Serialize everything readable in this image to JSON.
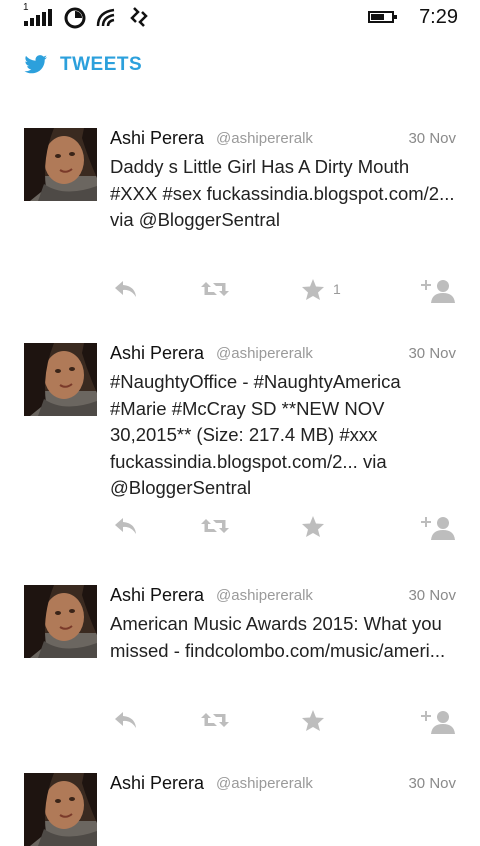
{
  "status_bar": {
    "signal_label": "1",
    "time": "7:29",
    "battery_level": 0.7
  },
  "header": {
    "icon": "twitter-bird-icon",
    "title": "TWEETS",
    "accent_color": "#2CA0DC"
  },
  "tweets": [
    {
      "name": "Ashi Perera",
      "handle": "@ashipereralk",
      "date": "30 Nov",
      "text": "Daddy s Little Girl Has A Dirty Mouth #XXX #sex fuckassindia.blogspot.com/2... via @BloggerSentral",
      "favorite_count": "1"
    },
    {
      "name": "Ashi Perera",
      "handle": "@ashipereralk",
      "date": "30 Nov",
      "text": "#NaughtyOffice -  #NaughtyAmerica #Marie #McCray SD **NEW NOV 30,2015** (Size: 217.4 MB) #xxx fuckassindia.blogspot.com/2... via @BloggerSentral",
      "favorite_count": ""
    },
    {
      "name": "Ashi Perera",
      "handle": "@ashipereralk",
      "date": "30 Nov",
      "text": "American Music Awards 2015: What you missed - findcolombo.com/music/ameri...",
      "favorite_count": ""
    },
    {
      "name": "Ashi Perera",
      "handle": "@ashipereralk",
      "date": "30 Nov",
      "text": "",
      "favorite_count": ""
    }
  ],
  "icon_color": "#BDBDBD"
}
